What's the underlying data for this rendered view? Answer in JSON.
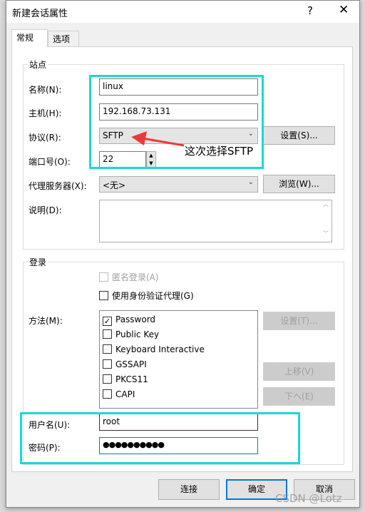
{
  "window": {
    "title": "新建会话属性",
    "help": "?",
    "close": "✕"
  },
  "tabs": [
    {
      "label": "常规",
      "active": true
    },
    {
      "label": "选项",
      "active": false
    }
  ],
  "site": {
    "legend": "站点",
    "name_label": "名称(N):",
    "name_value": "linux",
    "host_label": "主机(H):",
    "host_value": "192.168.73.131",
    "protocol_label": "协议(R):",
    "protocol_value": "SFTP",
    "protocol_settings": "设置(S)...",
    "port_label": "端口号(O):",
    "port_value": "22",
    "proxy_label": "代理服务器(X):",
    "proxy_value": "<无>",
    "proxy_browse": "浏览(W)...",
    "desc_label": "说明(D):",
    "desc_value": ""
  },
  "annotation": "这次选择SFTP",
  "login": {
    "legend": "登录",
    "anonymous_label": "匿名登录(A)",
    "anonymous_checked": false,
    "anonymous_disabled": true,
    "agent_label": "使用身份验证代理(G)",
    "agent_checked": false,
    "method_label": "方法(M):",
    "methods": [
      {
        "label": "Password",
        "checked": true
      },
      {
        "label": "Public Key",
        "checked": false
      },
      {
        "label": "Keyboard Interactive",
        "checked": false
      },
      {
        "label": "GSSAPI",
        "checked": false
      },
      {
        "label": "PKCS11",
        "checked": false
      },
      {
        "label": "CAPI",
        "checked": false
      }
    ],
    "method_settings": "设置(T)...",
    "move_up": "上移(V)",
    "move_down": "下へ(E)",
    "user_label": "用户名(U):",
    "user_value": "root",
    "password_label": "密码(P):",
    "password_value": "●●●●●●●●●●"
  },
  "footer": {
    "connect": "连接",
    "ok": "确定",
    "cancel": "取消"
  },
  "watermark": "CSDN @Lotz",
  "colors": {
    "highlight": "#1bd8d8",
    "arrow": "#e83a3a",
    "focus": "#0078d7"
  }
}
